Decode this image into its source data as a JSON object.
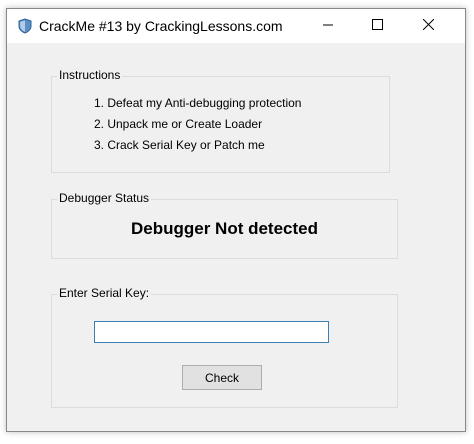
{
  "window": {
    "title": "CrackMe #13 by CrackingLessons.com",
    "icon": "shield-icon",
    "controls": {
      "minimize": "minimize-icon",
      "maximize": "maximize-icon",
      "close": "close-icon"
    }
  },
  "instructions": {
    "label": "Instructions",
    "items": [
      "1. Defeat my Anti-debugging protection",
      "2. Unpack me or Create Loader",
      "3. Crack Serial Key or Patch me"
    ]
  },
  "debugger_status": {
    "label": "Debugger Status",
    "text": "Debugger Not detected"
  },
  "serial": {
    "label": "Enter Serial Key:",
    "value": "",
    "button_label": "Check"
  },
  "colors": {
    "window_bg": "#f0f0f0",
    "titlebar_bg": "#ffffff",
    "input_border": "#3c7fb1",
    "button_bg": "#e1e1e1"
  }
}
